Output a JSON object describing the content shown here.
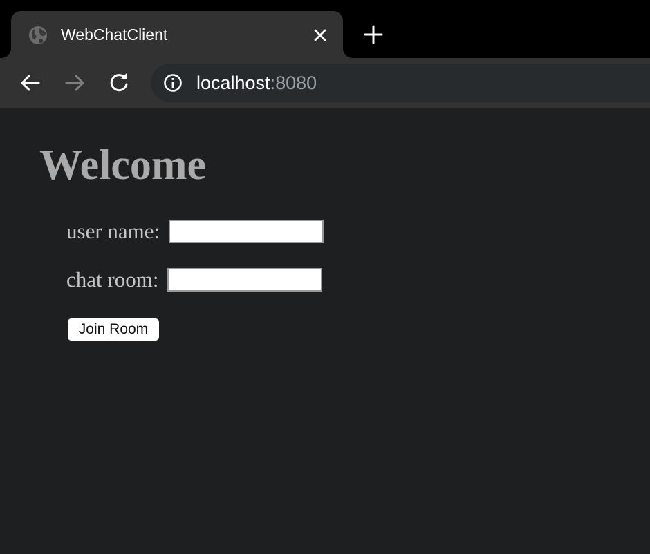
{
  "browser": {
    "tab": {
      "title": "WebChatClient",
      "favicon": "globe-icon"
    },
    "address_bar": {
      "host": "localhost",
      "port": ":8080",
      "security_icon": "info-icon"
    },
    "nav_icons": [
      "back-arrow-icon",
      "forward-arrow-icon",
      "reload-icon"
    ],
    "colors": {
      "tabstrip": "#000000",
      "active_tab": "#323233",
      "omnibox": "#282b2e",
      "page_background": "#1e1f21"
    }
  },
  "page": {
    "heading": "Welcome",
    "form": {
      "username_label": "user name:",
      "username_value": "",
      "chatroom_label": "chat room:",
      "chatroom_value": "",
      "submit_label": "Join Room"
    }
  }
}
